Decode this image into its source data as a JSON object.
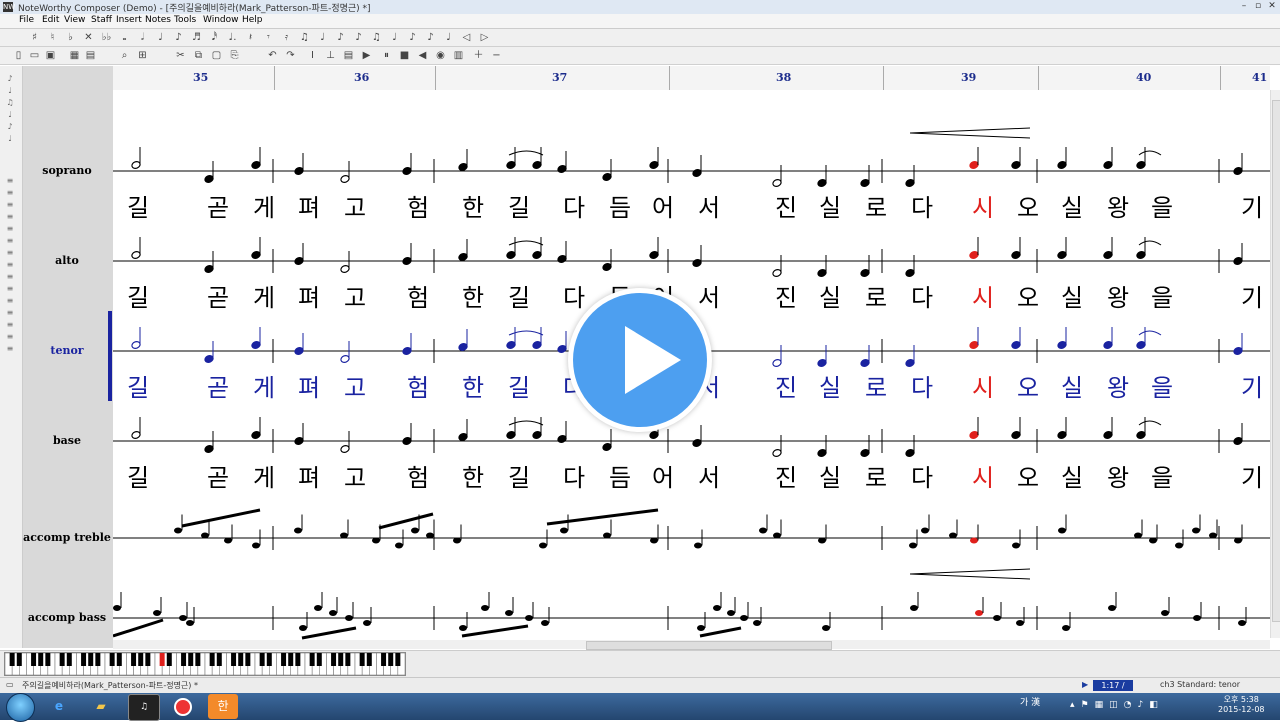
{
  "window": {
    "title": "NoteWorthy Composer (Demo) - [주의길을예비하라(Mark_Patterson-파트-정명근) *]",
    "app_icon": "NW"
  },
  "menu": [
    "File",
    "Edit",
    "View",
    "Staff",
    "Insert",
    "Notes",
    "Tools",
    "Window",
    "Help"
  ],
  "measures": [
    "35",
    "36",
    "37",
    "38",
    "39",
    "40",
    "41"
  ],
  "staves": [
    {
      "name": "soprano",
      "active": false
    },
    {
      "name": "alto",
      "active": false
    },
    {
      "name": "tenor",
      "active": true
    },
    {
      "name": "base",
      "active": false
    },
    {
      "name": "accomp treble",
      "active": false
    },
    {
      "name": "accomp bass",
      "active": false
    }
  ],
  "lyrics": {
    "soprano": [
      "길",
      "곧",
      "게",
      "펴",
      "고",
      "험",
      "한",
      "길",
      "다",
      "듬",
      "어",
      "서",
      "진",
      "실",
      "로",
      "다",
      "시",
      "오",
      "실",
      "왕",
      "을",
      "기"
    ],
    "alto": [
      "길",
      "곧",
      "게",
      "펴",
      "고",
      "험",
      "한",
      "길",
      "다",
      "듬",
      "어",
      "서",
      "진",
      "실",
      "로",
      "다",
      "시",
      "오",
      "실",
      "왕",
      "을",
      "기"
    ],
    "tenor": [
      "길",
      "곧",
      "게",
      "펴",
      "고",
      "험",
      "한",
      "길",
      "다",
      "듬",
      "어",
      "서",
      "진",
      "실",
      "로",
      "다",
      "시",
      "오",
      "실",
      "왕",
      "을",
      "기"
    ],
    "base": [
      "길",
      "곧",
      "게",
      "펴",
      "고",
      "험",
      "한",
      "길",
      "다",
      "듬",
      "어",
      "서",
      "진",
      "실",
      "로",
      "다",
      "시",
      "오",
      "실",
      "왕",
      "을",
      "기"
    ]
  },
  "highlighted_syllable_index": 16,
  "status": {
    "document": "주의길을예비하라(Mark_Patterson-파트-정명근) *",
    "time_position": "1:17 / 2:08",
    "staff_info": "ch3 Standard: tenor"
  },
  "taskbar": {
    "tray_text": "가 漢",
    "clock_time": "오후 5:38",
    "clock_date": "2015-12-08"
  },
  "colors": {
    "active_staff": "#1a23a0",
    "highlight_note": "#e0201c",
    "play_overlay": "#4d9ff0"
  },
  "overlay": {
    "icon": "play-icon"
  }
}
